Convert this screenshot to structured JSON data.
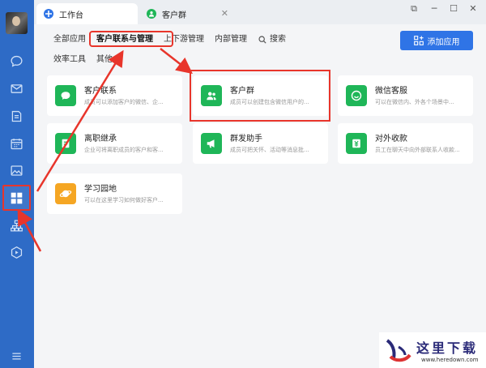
{
  "tabs": [
    {
      "label": "工作台"
    },
    {
      "label": "客户群"
    }
  ],
  "categories": [
    {
      "label": "全部应用"
    },
    {
      "label": "客户联系与管理"
    },
    {
      "label": "上下游管理"
    },
    {
      "label": "内部管理"
    },
    {
      "label": "搜索"
    },
    {
      "label": "效率工具"
    },
    {
      "label": "其他"
    }
  ],
  "add_app_label": "添加应用",
  "apps": [
    {
      "title": "客户联系",
      "desc": "成员可以添加客户的微信、企..."
    },
    {
      "title": "客户群",
      "desc": "成员可以创建包含微信用户的..."
    },
    {
      "title": "微信客服",
      "desc": "可以在微信内、外各个场景中..."
    },
    {
      "title": "离职继承",
      "desc": "企业可将离职成员的客户和客..."
    },
    {
      "title": "群发助手",
      "desc": "成员可把关怀、活动等消息批..."
    },
    {
      "title": "对外收款",
      "desc": "员工在聊天中向外部联系人收款..."
    },
    {
      "title": "学习园地",
      "desc": "可以在这里学习如何做好客户..."
    }
  ],
  "watermark": {
    "text": "这里下载",
    "url": "www.heredown.com"
  },
  "colors": {
    "sidebar": "#2e6bc6",
    "accent": "#2f74e6",
    "app_green": "#1fb658",
    "app_orange": "#f5a623",
    "annotation_red": "#e8352b"
  }
}
